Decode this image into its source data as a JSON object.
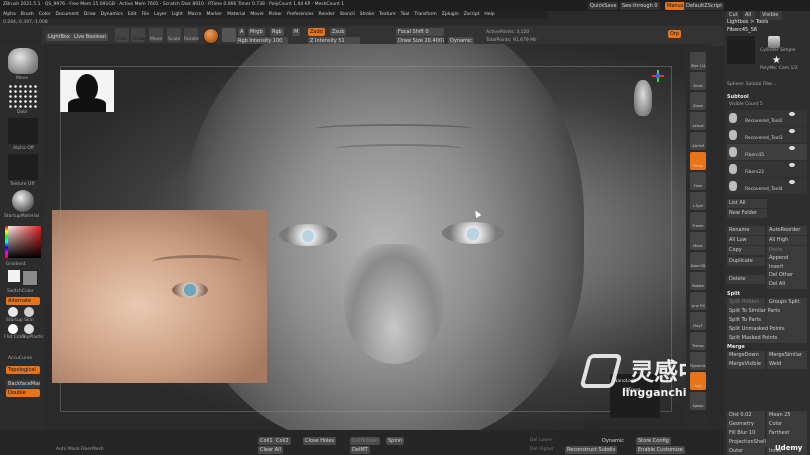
{
  "menubar": {
    "status": "ZBrush 2021.5.1 · QS_9976 · Free Mem 15.691GB · Active Mem 7601 · Scratch Disk 8910 · RTime 0.066 Timer 0.738 · PolyCount 1.44 KP · MeshCount 1",
    "quicksave": "QuickSave",
    "see_through": "See-through  0",
    "menus_label": "Menus",
    "script": "DefaultZScript",
    "items": [
      "Alpha",
      "Brush",
      "Color",
      "Document",
      "Draw",
      "Dynamics",
      "Edit",
      "File",
      "Layer",
      "Light",
      "Macro",
      "Marker",
      "Material",
      "Movie",
      "Picker",
      "Preferences",
      "Render",
      "Stencil",
      "Stroke",
      "Texture",
      "Tool",
      "Transform",
      "Zplugin",
      "Zscript",
      "Help"
    ]
  },
  "coords": "0.284,-0.397,-1.008",
  "toolbar": {
    "lightbox": "LightBox",
    "live_boolean": "Live Boolean",
    "edit": "Edit",
    "draw": "Draw",
    "move": "Move",
    "scale": "Scale",
    "rotate": "Rotate",
    "a_btn": "A",
    "mrgb": "Mrgb",
    "rgb": "Rgb",
    "m": "M",
    "zadd": "Zadd",
    "zsub": "Zsub",
    "rgb_intensity": "Rgb Intensity 100",
    "z_intensity": "Z Intensity 51",
    "focal_shift": "Focal Shift 0",
    "draw_size": "Draw Size 20.40075",
    "dynamic": "Dynamic",
    "active_points": "ActivePoints: 3,120",
    "total_points": "TotalPoints: 91,679 Mil",
    "orp": "Orp"
  },
  "left_shelf": {
    "move": "Move",
    "dots": "Dots",
    "alpha_off": "Alpha Off",
    "texture_off": "Texture Off",
    "startup_material": "StartupMaterial",
    "gradient": "Gradient",
    "switch_color": "SwitchColor",
    "alternate": "Alternate",
    "startup_skin": "Startup Skin",
    "flat_color": "Flat Color",
    "toyplastic": "ToyPlastic",
    "accucurve": "AccuCurve",
    "topological": "Topological",
    "backface_mask": "BackfaceMask",
    "double": "Double"
  },
  "right_shelf": [
    "Sfye 1/4",
    "Scroll",
    "Zoom",
    "Actual",
    "AAHalf",
    "Persp",
    "Floor",
    "L.Sym",
    "Frame",
    "Move",
    "Zoom3D",
    "Rotate",
    "Line Fill",
    "PolyF",
    "Transp",
    "Dynamic",
    "Solo",
    "Xpose"
  ],
  "right_panel": {
    "header_left": "Cut",
    "header_a": "All",
    "header_vis": "Visible",
    "lightbox_tools": "Lightbox > Tools",
    "tool_name": "Fiberc45_S6",
    "cylinder": "Cylinder Simple",
    "polymesh": "PolyMe: Cam 1/2",
    "sphere": "Sphere: Solutai Fibe...",
    "subtool": "Subtool",
    "visible_count": "Visible Count 5",
    "subtools": [
      "Recovered_Tool2",
      "Recovered_Tool3",
      "Fiberc45",
      "Fibers22",
      "Recovered_Tool4"
    ],
    "list_all": "List All",
    "new_folder": "New Folder",
    "rename": "Rename",
    "autoreorder": "AutoReorder",
    "all_low": "All Low",
    "all_high": "All High",
    "copy": "Copy",
    "paste": "Paste",
    "duplicate": "Duplicate",
    "append": "Append",
    "insert": "Insert",
    "delete": "Delete",
    "del_other": "Del Other",
    "del_all": "Del All",
    "split": "Split",
    "split_hidden": "Split Hidden",
    "groups_split": "Groups Split",
    "split_similar": "Split To Similar Parts",
    "split_parts": "Split To Parts",
    "split_unmasked": "Split Unmasked Points",
    "split_masked": "Split Masked Points",
    "merge": "Merge",
    "merge_down": "MergeDown",
    "merge_similar": "MergeSimilar",
    "merge_visible": "MergeVisible",
    "weld": "Weld",
    "dist": "Dist 0.02",
    "mean": "Mean 25",
    "geometry": "Geometry",
    "color": "Color",
    "fill_blur": "Fill Blur 10",
    "farthest": "Farthest",
    "projection_shell": "ProjectionShell",
    "outer": "Outer",
    "inner": "Inner"
  },
  "bottom_bar": {
    "hint": "Auto Mask FiberMesh",
    "coll": "Coll1",
    "coll2": "Coll2",
    "clear_all": "Clear All",
    "close_holes": "Close Holes",
    "delhidden": "DelHidden",
    "spinn": "Spinn",
    "del_mt": "DelMT",
    "del_lower": "Del Lower",
    "del_higher": "Del Higher",
    "dynamic": "Dynamic",
    "reconstruct": "Reconstruct Subdiv",
    "store_config": "Store Config",
    "enable_customize": "Enable Customize"
  },
  "overlays": {
    "nanolock": "NanoLock",
    "qifresa": "QiFresa",
    "watermark_cn": "灵感中国",
    "watermark_url": "lingganchina.com",
    "udemy": "Udemy"
  },
  "colors": {
    "accent": "#e8741a",
    "panel": "#2e2e2e",
    "button": "#4a4a4a"
  }
}
